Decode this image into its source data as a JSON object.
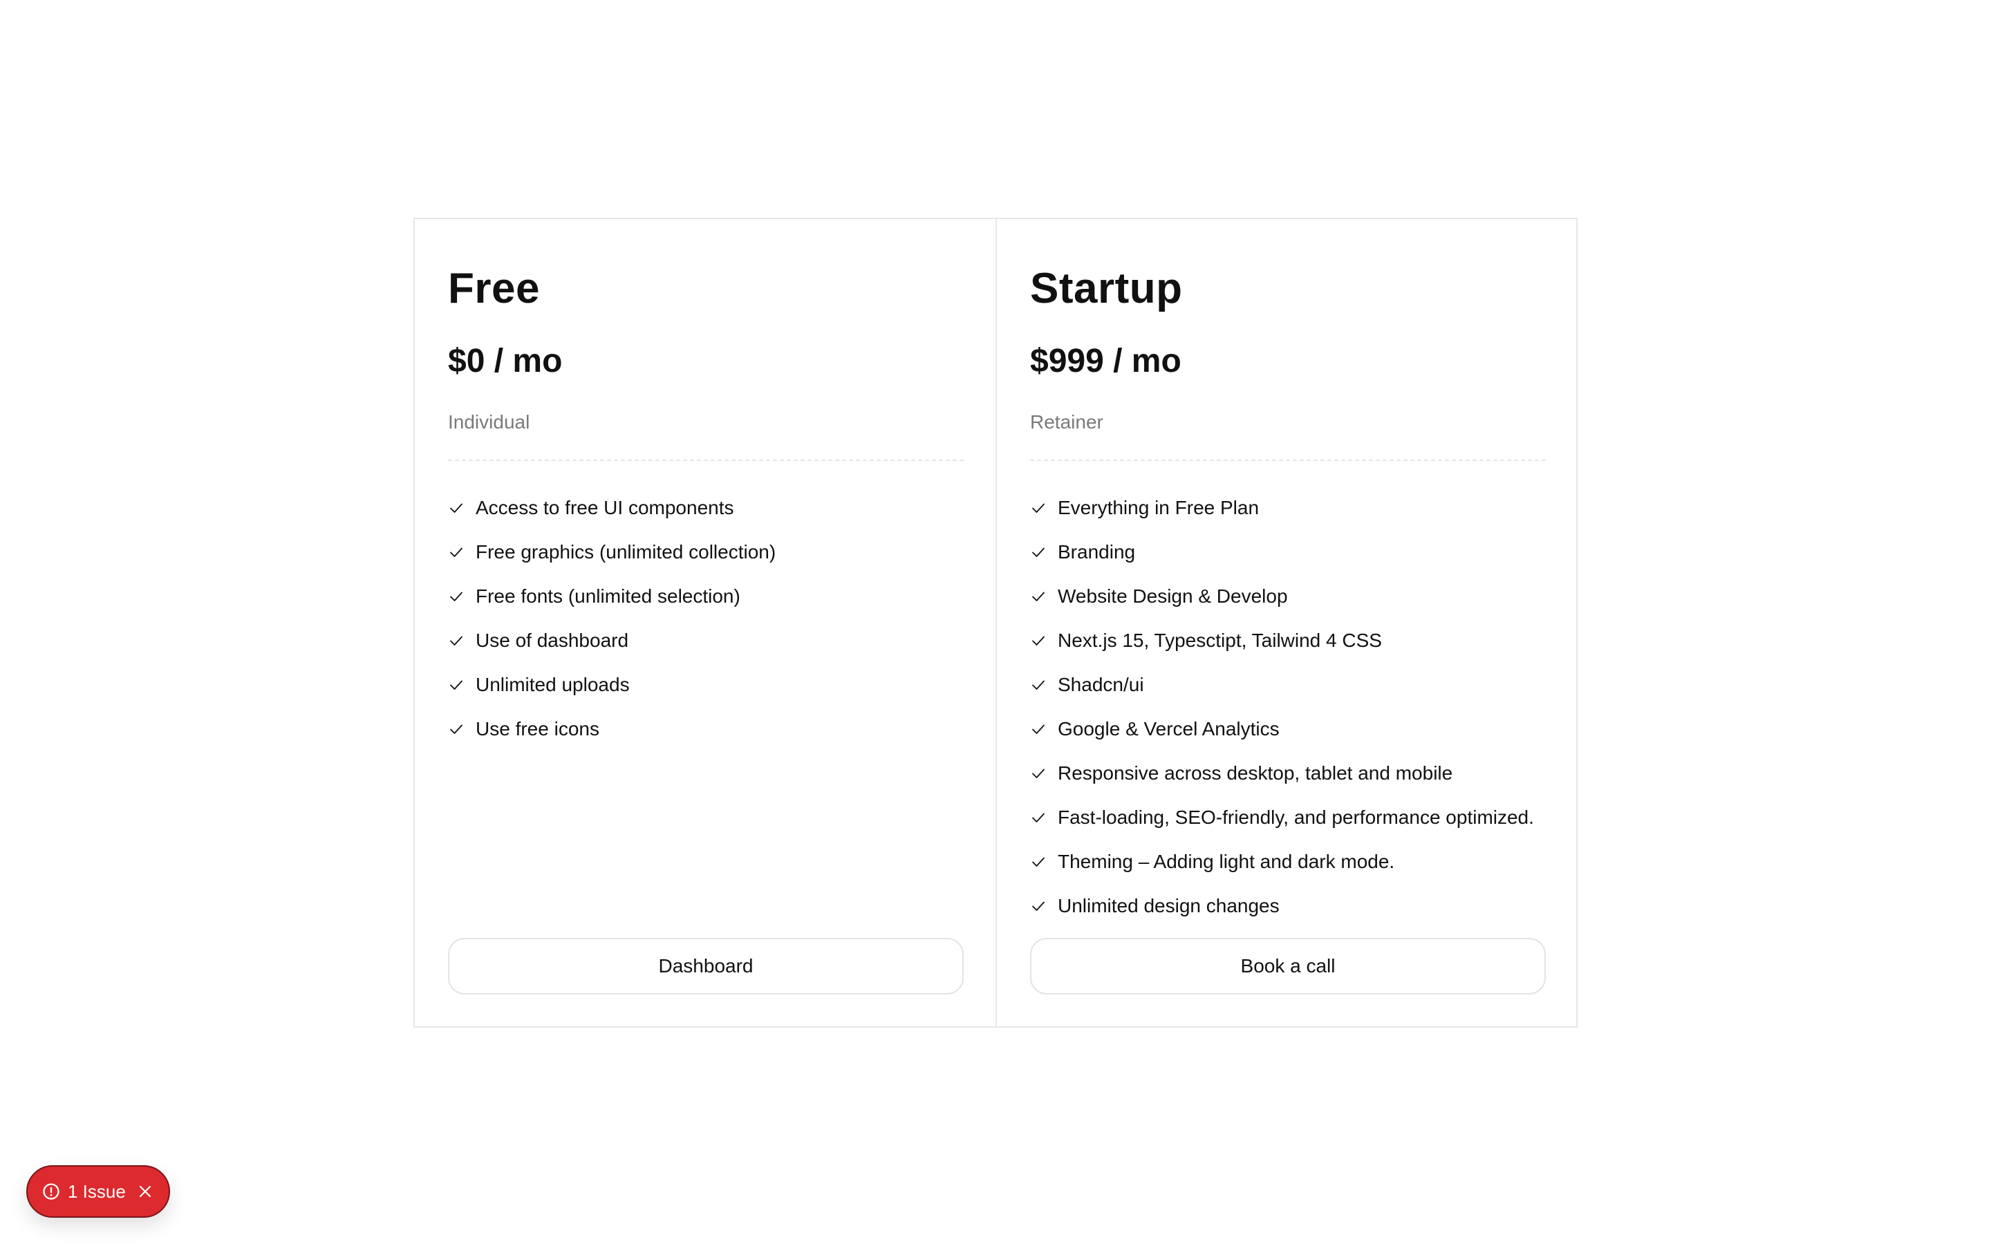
{
  "plans": [
    {
      "name": "Free",
      "price": "$0 / mo",
      "subtitle": "Individual",
      "features": [
        "Access to free UI components",
        "Free graphics (unlimited collection)",
        "Free fonts (unlimited selection)",
        "Use of dashboard",
        "Unlimited uploads",
        "Use free icons"
      ],
      "cta_label": "Dashboard"
    },
    {
      "name": "Startup",
      "price": "$999 / mo",
      "subtitle": "Retainer",
      "features": [
        "Everything in Free Plan",
        "Branding",
        "Website Design & Develop",
        "Next.js 15, Typesctipt, Tailwind 4 CSS",
        "Shadcn/ui",
        "Google & Vercel Analytics",
        "Responsive across desktop, tablet and mobile",
        "Fast-loading, SEO-friendly, and performance optimized.",
        "Theming – Adding light and dark mode.",
        "Unlimited design changes"
      ],
      "cta_label": "Book a call"
    }
  ],
  "issue_badge": {
    "label": "1 Issue",
    "icon": "alert-circle-icon",
    "close_icon": "close-icon",
    "color": "#dc2a2e"
  },
  "colors": {
    "border": "#e7e7e7",
    "muted_text": "#7a7a7a",
    "text": "#111111"
  }
}
